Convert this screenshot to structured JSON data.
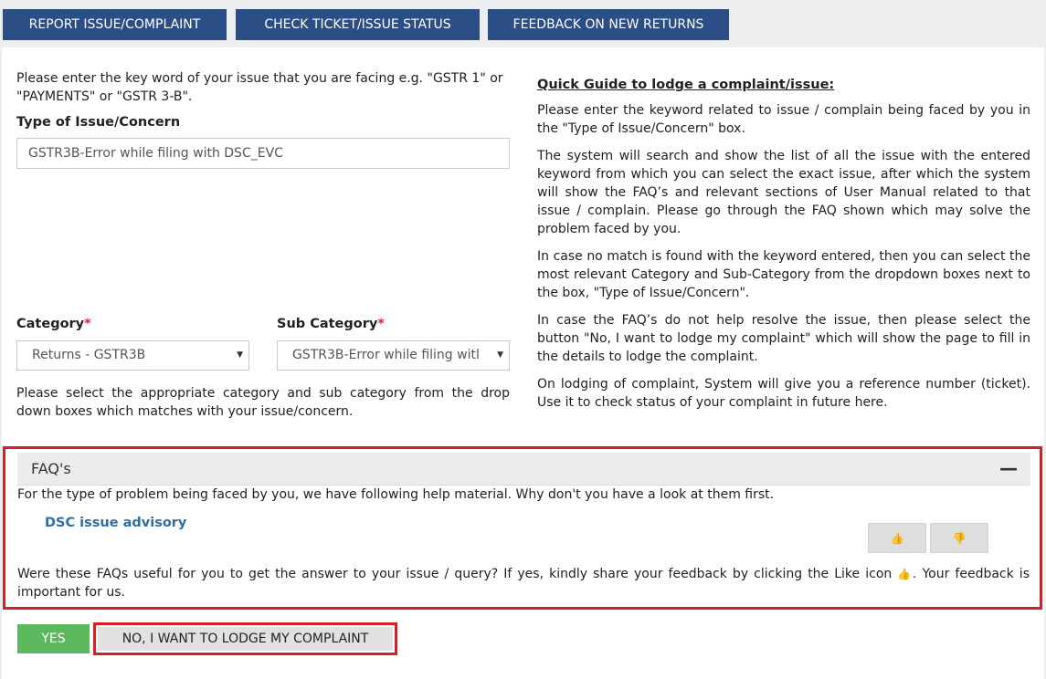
{
  "tabs": {
    "report": "REPORT ISSUE/COMPLAINT",
    "status": "CHECK TICKET/ISSUE STATUS",
    "feedback": "FEEDBACK ON NEW RETURNS"
  },
  "form": {
    "intro": "Please enter the key word of your issue that you are facing e.g. \"GSTR 1\" or \"PAYMENTS\" or \"GSTR 3-B\".",
    "type_label": "Type of Issue/Concern",
    "type_value": "GSTR3B-Error while filing with DSC_EVC",
    "category_label": "Category",
    "category_value": "Returns - GSTR3B",
    "subcategory_label": "Sub Category",
    "subcategory_value": "GSTR3B-Error while filing witl",
    "required_mark": "*",
    "select_help": "Please select the appropriate category and sub category from the drop down boxes which matches with your issue/concern."
  },
  "guide": {
    "title": "Quick Guide to lodge a complaint/issue:",
    "p1": "Please enter the keyword related to issue / complain being faced by you in the \"Type of Issue/Concern\" box.",
    "p2": "The system will search and show the list of all the issue with the entered keyword from which you can select the exact issue, after which the system will show the FAQ’s and relevant sections of User Manual related to that issue / complain. Please go through the FAQ shown which may solve the problem faced by you.",
    "p3": "In case no match is found with the keyword entered, then you can select the most relevant Category and Sub-Category from the dropdown boxes next to the box, \"Type of Issue/Concern\".",
    "p4": "In case the FAQ’s do not help resolve the issue, then please select the button \"No, I want to lodge my complaint\" which will show the page to fill in the details to lodge the complaint.",
    "p5": "On lodging of complaint, System will give you a reference number (ticket). Use it to check status of your complaint in future here."
  },
  "faq": {
    "title": "FAQ's",
    "collapse": "—",
    "intro": "For the type of problem being faced by you, we have following help material. Why don't you have a look at them first.",
    "link": "DSC issue advisory",
    "like_icon": "👍",
    "dislike_icon": "👎",
    "useful_text_a": "Were these FAQs useful for you to get the answer to your issue / query? If yes, kindly share your feedback by clicking the Like icon",
    "useful_text_b": ". Your feedback is important for us."
  },
  "actions": {
    "yes": "YES",
    "no": "NO, I WANT TO LODGE MY COMPLAINT"
  },
  "colors": {
    "tab": "#2c4e86",
    "highlight": "#d42128",
    "yes": "#5cb85c",
    "link": "#2d6ea6"
  }
}
